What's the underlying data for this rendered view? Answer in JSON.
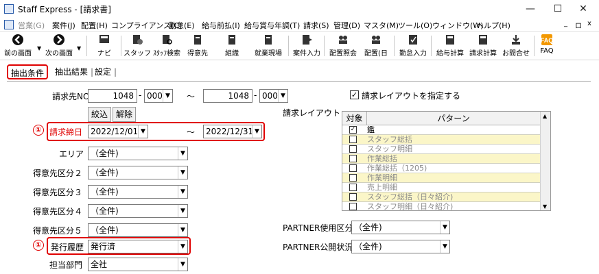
{
  "window": {
    "title": "Staff Express - [請求書]",
    "controls": [
      "—",
      "☐",
      "✕"
    ]
  },
  "menu": {
    "items": [
      {
        "label": "営業(G)",
        "dim": true
      },
      {
        "label": "案件(J)",
        "dim": false
      },
      {
        "label": "配置(H)",
        "dim": false
      },
      {
        "label": "コンプライアンス(C)",
        "dim": false
      },
      {
        "label": "勤怠(E)",
        "dim": false
      },
      {
        "label": "給与前払(I)",
        "dim": false
      },
      {
        "label": "給与賞与年調(T)",
        "dim": false
      },
      {
        "label": "請求(S)",
        "dim": false
      },
      {
        "label": "管理(D)",
        "dim": false
      },
      {
        "label": "マスタ(M)",
        "dim": false
      },
      {
        "label": "ツール(O)",
        "dim": false
      },
      {
        "label": "ウィンドウ(W)",
        "dim": false
      },
      {
        "label": "ヘルプ(H)",
        "dim": false
      }
    ],
    "mdi_controls": [
      "_",
      "ロ",
      "x"
    ]
  },
  "toolbar": {
    "prev": "前の画面",
    "next": "次の画面",
    "buttons": [
      "ナビ",
      "スタッフ",
      "ｽﾀｯﾌ検索",
      "得意先",
      "組織",
      "就業現場",
      "案件入力",
      "配置照会",
      "配置(日",
      "勤怠入力",
      "給与計算",
      "請求計算",
      "お問合せ",
      "FAQ"
    ]
  },
  "tabs": [
    "抽出条件",
    "抽出結果",
    "設定"
  ],
  "form": {
    "billing_no_label": "請求先NO",
    "billing_from": "1048",
    "billing_from_branch": "000",
    "tilde": "～",
    "billing_to": "1048",
    "billing_to_branch": "000",
    "narrow_button": "絞込",
    "clear_button": "解除",
    "closing_date_label": "請求締日",
    "closing_from": "2022/12/01",
    "closing_to": "2022/12/31",
    "area_label": "エリア",
    "area_value": "（全件)",
    "cust_div2_label": "得意先区分２",
    "cust_div2_value": "（全件)",
    "cust_div3_label": "得意先区分３",
    "cust_div3_value": "（全件)",
    "cust_div4_label": "得意先区分４",
    "cust_div4_value": "（全件)",
    "cust_div5_label": "得意先区分５",
    "cust_div5_value": "（全件)",
    "issue_history_label": "発行履歴",
    "issue_history_value": "発行済",
    "dept_label": "担当部門",
    "dept_value": "全社",
    "marker": "①"
  },
  "layout": {
    "specify_label": "請求レイアウトを指定する",
    "specify_checked": "✓",
    "list_label": "請求レイアウト",
    "col_target": "対象",
    "col_pattern": "パターン",
    "rows": [
      {
        "name": "鑑",
        "checked": "✓",
        "dim": false,
        "hl": false
      },
      {
        "name": "スタッフ総括",
        "checked": "",
        "dim": true,
        "hl": true
      },
      {
        "name": "スタッフ明細",
        "checked": "",
        "dim": true,
        "hl": false
      },
      {
        "name": "作業総括",
        "checked": "",
        "dim": true,
        "hl": true
      },
      {
        "name": "作業総括（1205)",
        "checked": "",
        "dim": true,
        "hl": false
      },
      {
        "name": "作業明細",
        "checked": "",
        "dim": true,
        "hl": true
      },
      {
        "name": "売上明細",
        "checked": "",
        "dim": true,
        "hl": false
      },
      {
        "name": "スタッフ総括（日々紹介)",
        "checked": "",
        "dim": true,
        "hl": true
      },
      {
        "name": "スタッフ明細（日々紹介)",
        "checked": "",
        "dim": true,
        "hl": false
      }
    ],
    "partner_use_label": "PARTNER使用区分",
    "partner_use_value": "（全件)",
    "partner_pub_label": "PARTNER公開状況",
    "partner_pub_value": "（全件)"
  },
  "colors": {
    "highlight_red": "#e00000",
    "row_yellow": "#fbf6c8",
    "dim_text": "#8a8a8a"
  }
}
